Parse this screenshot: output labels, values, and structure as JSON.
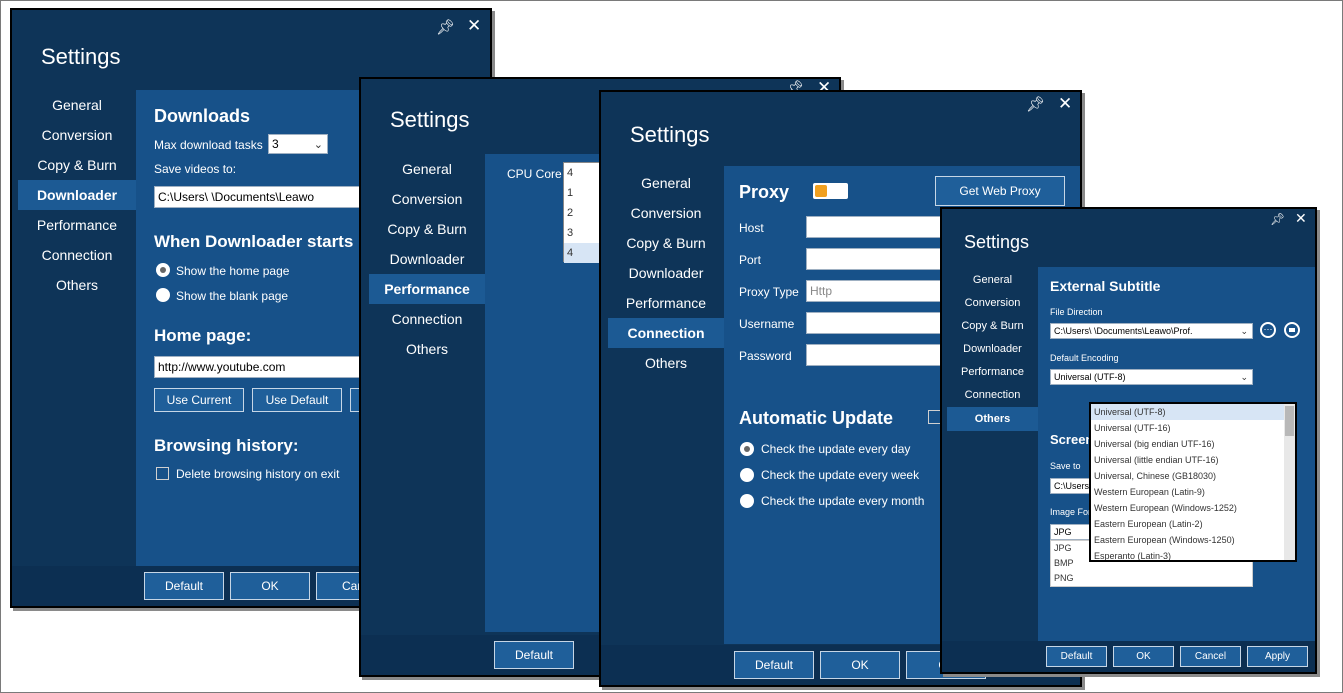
{
  "windows": [
    {
      "title": "Settings",
      "nav": [
        "General",
        "Conversion",
        "Copy & Burn",
        "Downloader",
        "Performance",
        "Connection",
        "Others"
      ],
      "active_nav": "Downloader",
      "downloads": {
        "heading": "Downloads",
        "max_tasks_label": "Max download tasks",
        "max_tasks_value": "3",
        "save_label": "Save videos to:",
        "save_path": "C:\\Users\\            \\Documents\\Leawo"
      },
      "when_start": {
        "heading": "When Downloader starts",
        "options": [
          "Show the home page",
          "Show the blank page"
        ]
      },
      "home_page": {
        "heading": "Home page:",
        "url": "http://www.youtube.com",
        "buttons": [
          "Use Current",
          "Use Default"
        ]
      },
      "history": {
        "heading": "Browsing history:",
        "delete_label": "Delete browsing history on exit"
      },
      "footer": [
        "Default",
        "OK",
        "Canc"
      ]
    },
    {
      "title": "Settings",
      "nav": [
        "General",
        "Conversion",
        "Copy & Burn",
        "Downloader",
        "Performance",
        "Connection",
        "Others"
      ],
      "active_nav": "Performance",
      "cpu_label": "CPU Core",
      "cpu_options": [
        "4",
        "1",
        "2",
        "3",
        "4"
      ],
      "footer": [
        "Default"
      ]
    },
    {
      "title": "Settings",
      "nav": [
        "General",
        "Conversion",
        "Copy & Burn",
        "Downloader",
        "Performance",
        "Connection",
        "Others"
      ],
      "active_nav": "Connection",
      "proxy": {
        "heading": "Proxy",
        "get_button": "Get Web Proxy",
        "fields": [
          "Host",
          "Port",
          "Proxy Type",
          "Username",
          "Password"
        ],
        "proxy_type_placeholder": "Http"
      },
      "update": {
        "heading": "Automatic Update",
        "options": [
          "Check the update every day",
          "Check the update every week",
          "Check the update every month"
        ]
      },
      "footer": [
        "Default",
        "OK",
        "Ca"
      ]
    },
    {
      "title": "Settings",
      "nav": [
        "General",
        "Conversion",
        "Copy & Burn",
        "Downloader",
        "Performance",
        "Connection",
        "Others"
      ],
      "active_nav": "Others",
      "subtitle": {
        "heading": "External Subtitle",
        "file_dir_label": "File Direction",
        "file_dir_value": "C:\\Users\\            \\Documents\\Leawo\\Prof.",
        "encoding_label": "Default Encoding",
        "encoding_value": "Universal (UTF-8)"
      },
      "encoding_options": [
        "Universal (UTF-8)",
        "Universal (UTF-16)",
        "Universal (big endian UTF-16)",
        "Universal (little endian UTF-16)",
        "Universal, Chinese (GB18030)",
        "Western European (Latin-9)",
        "Western European (Windows-1252)",
        "Eastern European (Latin-2)",
        "Eastern European (Windows-1250)",
        "Esperanto (Latin-3)"
      ],
      "screenshot": {
        "heading": "Screen",
        "save_label": "Save to",
        "save_value": "C:\\Users\\",
        "format_label": "Image For",
        "format_value": "JPG",
        "format_options": [
          "JPG",
          "BMP",
          "PNG"
        ]
      },
      "footer": [
        "Default",
        "OK",
        "Cancel",
        "Apply"
      ]
    }
  ],
  "icons": {
    "pin": "pin-icon",
    "close": "close-icon",
    "more": "more-icon",
    "folder": "folder-icon"
  }
}
